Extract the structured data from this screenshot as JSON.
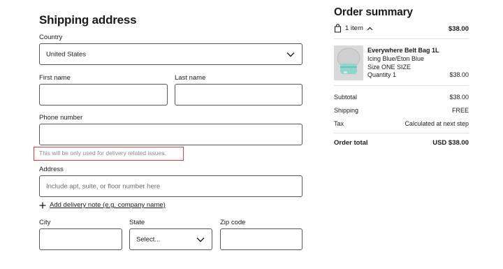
{
  "shipping": {
    "title": "Shipping address",
    "country_label": "Country",
    "country_value": "United States",
    "first_name_label": "First name",
    "last_name_label": "Last name",
    "phone_label": "Phone number",
    "phone_hint": "This will be only used for delivery related issues.",
    "address_label": "Address",
    "address_placeholder": "Include apt, suite, or floor number here",
    "add_note_label": "Add delivery note (e.g. company name)",
    "city_label": "City",
    "state_label": "State",
    "state_value": "Select...",
    "zip_label": "Zip code"
  },
  "summary": {
    "title": "Order summary",
    "item_count": "1 item",
    "header_total": "$38.00",
    "product": {
      "name": "Everywhere Belt Bag 1L",
      "color": "Icing Blue/Eton Blue",
      "size": "Size ONE SIZE",
      "quantity": "Quantity 1",
      "price": "$38.00"
    },
    "subtotal_label": "Subtotal",
    "subtotal_value": "$38.00",
    "shipping_label": "Shipping",
    "shipping_value": "FREE",
    "tax_label": "Tax",
    "tax_value": "Calculated at next step",
    "total_label": "Order total",
    "total_value": "USD $38.00"
  },
  "colors": {
    "highlight": "#e03a3a",
    "border": "#555555",
    "text": "#1a1a1a",
    "muted": "#8a8a8a"
  }
}
